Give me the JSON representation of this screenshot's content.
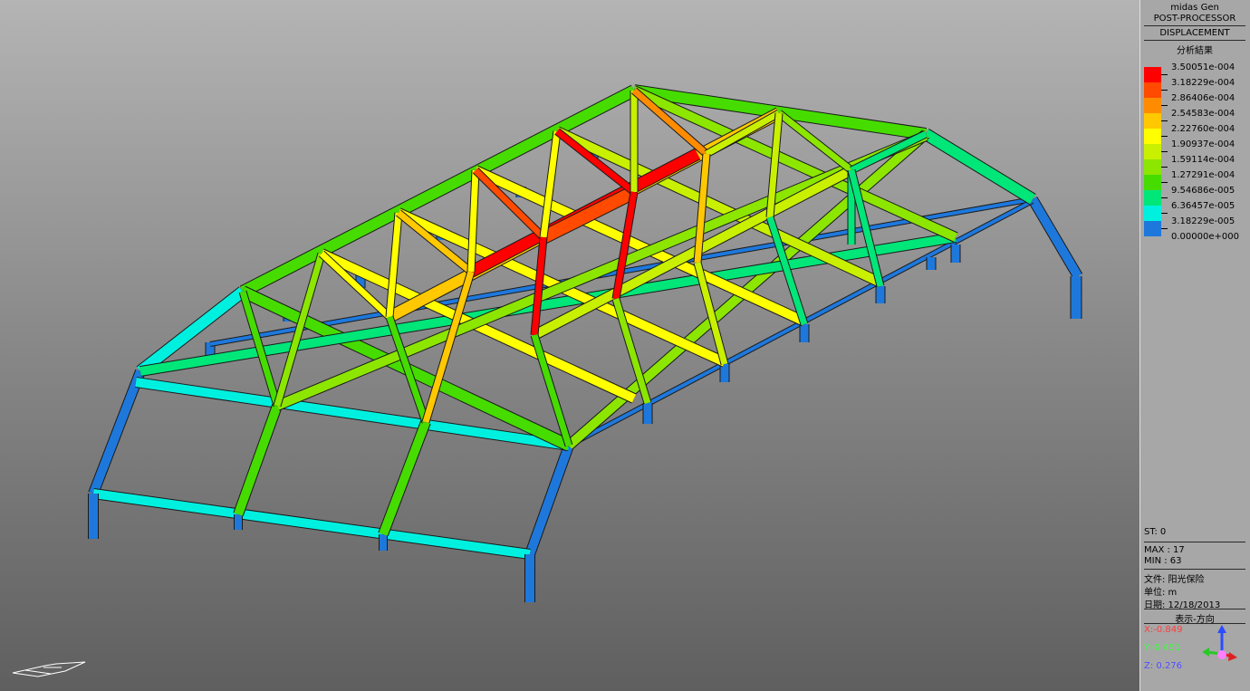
{
  "header": {
    "app_name": "midas Gen",
    "module": "POST-PROCESSOR",
    "result_type": "DISPLACEMENT",
    "analysis_title": "分析結果"
  },
  "legend": [
    {
      "value": "3.50051e-004",
      "color": "#ff0000"
    },
    {
      "value": "3.18229e-004",
      "color": "#ff4a00"
    },
    {
      "value": "2.86406e-004",
      "color": "#ff8c00"
    },
    {
      "value": "2.54583e-004",
      "color": "#ffc800"
    },
    {
      "value": "2.22760e-004",
      "color": "#ffff00"
    },
    {
      "value": "1.90937e-004",
      "color": "#c8f000"
    },
    {
      "value": "1.59114e-004",
      "color": "#8ce600"
    },
    {
      "value": "1.27291e-004",
      "color": "#46dc00"
    },
    {
      "value": "9.54686e-005",
      "color": "#00e678"
    },
    {
      "value": "6.36457e-005",
      "color": "#00f0e0"
    },
    {
      "value": "3.18229e-005",
      "color": "#1e78dc"
    },
    {
      "value": "0.00000e+000",
      "color": null
    }
  ],
  "info": {
    "step": "ST: 0",
    "max": "MAX : 17",
    "min": "MIN : 63",
    "file": "文件: 阳光保险",
    "unit": "单位: m",
    "date": "日期: 12/18/2013",
    "view_direction": "表示-方向"
  },
  "view_vector": {
    "x": "X:-0.849",
    "y": "Y:-0.451",
    "z": "Z: 0.276",
    "x_color": "#ff3c3c",
    "y_color": "#3cff3c",
    "z_color": "#5050ff"
  }
}
